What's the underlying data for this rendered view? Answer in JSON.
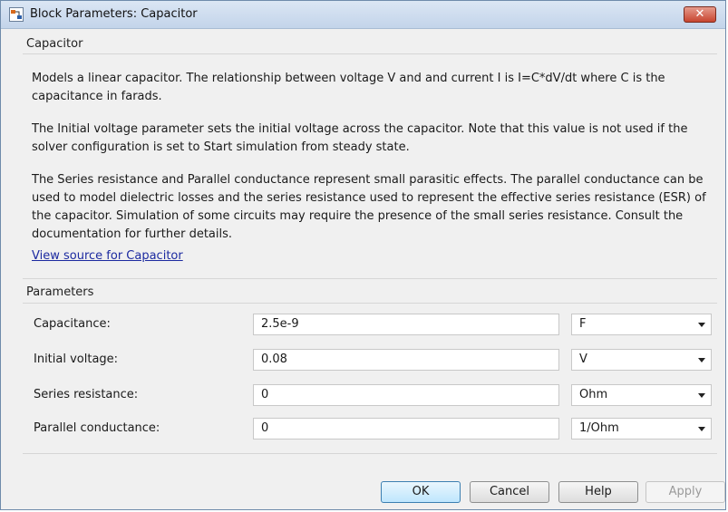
{
  "window": {
    "title": "Block Parameters: Capacitor",
    "close_glyph": "✕"
  },
  "description": {
    "section_title": "Capacitor",
    "paragraphs": [
      "Models a linear capacitor. The relationship between voltage V and and current I is I=C*dV/dt where C is the capacitance in farads.",
      "The Initial voltage parameter sets the initial voltage across the capacitor. Note that this value is not used if the solver configuration is set to Start simulation from steady state.",
      "The Series resistance and Parallel conductance represent small parasitic effects. The parallel conductance can be used to model dielectric losses and the series resistance used to represent the effective series resistance (ESR) of the capacitor. Simulation of some circuits may require the presence of the small series resistance. Consult the documentation for further details."
    ],
    "link_text": "View source for Capacitor"
  },
  "parameters": {
    "section_title": "Parameters",
    "rows": [
      {
        "label": "Capacitance:",
        "value": "2.5e-9",
        "unit": "F"
      },
      {
        "label": "Initial voltage:",
        "value": "0.08",
        "unit": "V"
      },
      {
        "label": "Series resistance:",
        "value": "0",
        "unit": "Ohm"
      },
      {
        "label": "Parallel conductance:",
        "value": "0",
        "unit": "1/Ohm"
      }
    ]
  },
  "buttons": {
    "ok": "OK",
    "cancel": "Cancel",
    "help": "Help",
    "apply": "Apply"
  },
  "colors": {
    "link": "#1c2aa0",
    "ok_border": "#3c7fb1",
    "close_red": "#c7452f"
  }
}
